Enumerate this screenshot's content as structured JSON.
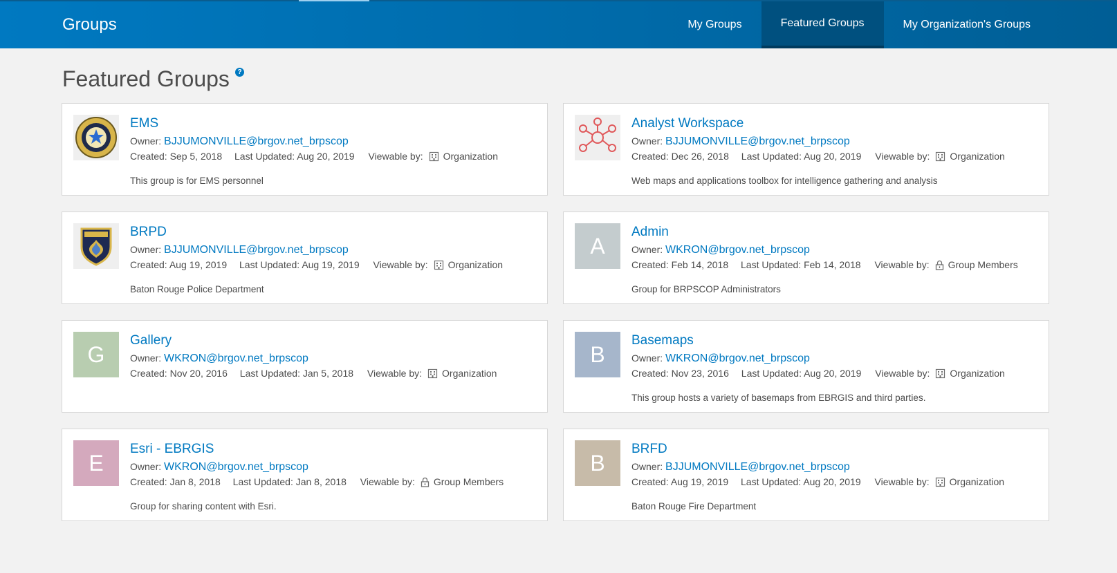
{
  "header": {
    "title": "Groups",
    "tabs": [
      {
        "label": "My Groups",
        "active": false
      },
      {
        "label": "Featured Groups",
        "active": true
      },
      {
        "label": "My Organization's Groups",
        "active": false
      }
    ],
    "colors": {
      "bar": "#0079c1",
      "active_tab": "#00507f"
    }
  },
  "page": {
    "title": "Featured Groups",
    "help_icon": "?"
  },
  "labels": {
    "owner": "Owner:",
    "created": "Created:",
    "updated": "Last Updated:",
    "viewable": "Viewable by:"
  },
  "groups": [
    {
      "name": "EMS",
      "owner": "BJJUMONVILLE@brgov.net_brpscop",
      "created": "Sep 5, 2018",
      "updated": "Aug 20, 2019",
      "viewable": "Organization",
      "description": "This group is for EMS personnel",
      "thumb": "ems-seal-icon"
    },
    {
      "name": "Analyst Workspace",
      "owner": "BJJUMONVILLE@brgov.net_brpscop",
      "created": "Dec 26, 2018",
      "updated": "Aug 20, 2019",
      "viewable": "Organization",
      "description": "Web maps and applications toolbox for intelligence gathering and analysis",
      "thumb": "network-icon"
    },
    {
      "name": "BRPD",
      "owner": "BJJUMONVILLE@brgov.net_brpscop",
      "created": "Aug 19, 2019",
      "updated": "Aug 19, 2019",
      "viewable": "Organization",
      "description": "Baton Rouge Police Department",
      "thumb": "police-badge-icon"
    },
    {
      "name": "Admin",
      "owner": "WKRON@brgov.net_brpscop",
      "created": "Feb 14, 2018",
      "updated": "Feb 14, 2018",
      "viewable": "Group Members",
      "description": "Group for BRPSCOP Administrators",
      "thumb_letter": "A",
      "thumb_color": "#c4ccce"
    },
    {
      "name": "Gallery",
      "owner": "WKRON@brgov.net_brpscop",
      "created": "Nov 20, 2016",
      "updated": "Jan 5, 2018",
      "viewable": "Organization",
      "description": "",
      "thumb_letter": "G",
      "thumb_color": "#b8cdb0"
    },
    {
      "name": "Basemaps",
      "owner": "WKRON@brgov.net_brpscop",
      "created": "Nov 23, 2016",
      "updated": "Aug 20, 2019",
      "viewable": "Organization",
      "description": "This group hosts a variety of basemaps from EBRGIS and third parties.",
      "thumb_letter": "B",
      "thumb_color": "#a6b6cb"
    },
    {
      "name": "Esri - EBRGIS",
      "owner": "WKRON@brgov.net_brpscop",
      "created": "Jan 8, 2018",
      "updated": "Jan 8, 2018",
      "viewable": "Group Members",
      "description": "Group for sharing content with Esri.",
      "thumb_letter": "E",
      "thumb_color": "#d4a9bd"
    },
    {
      "name": "BRFD",
      "owner": "BJJUMONVILLE@brgov.net_brpscop",
      "created": "Aug 19, 2019",
      "updated": "Aug 20, 2019",
      "viewable": "Organization",
      "description": "Baton Rouge Fire Department",
      "thumb_letter": "B",
      "thumb_color": "#c7bba9"
    }
  ]
}
